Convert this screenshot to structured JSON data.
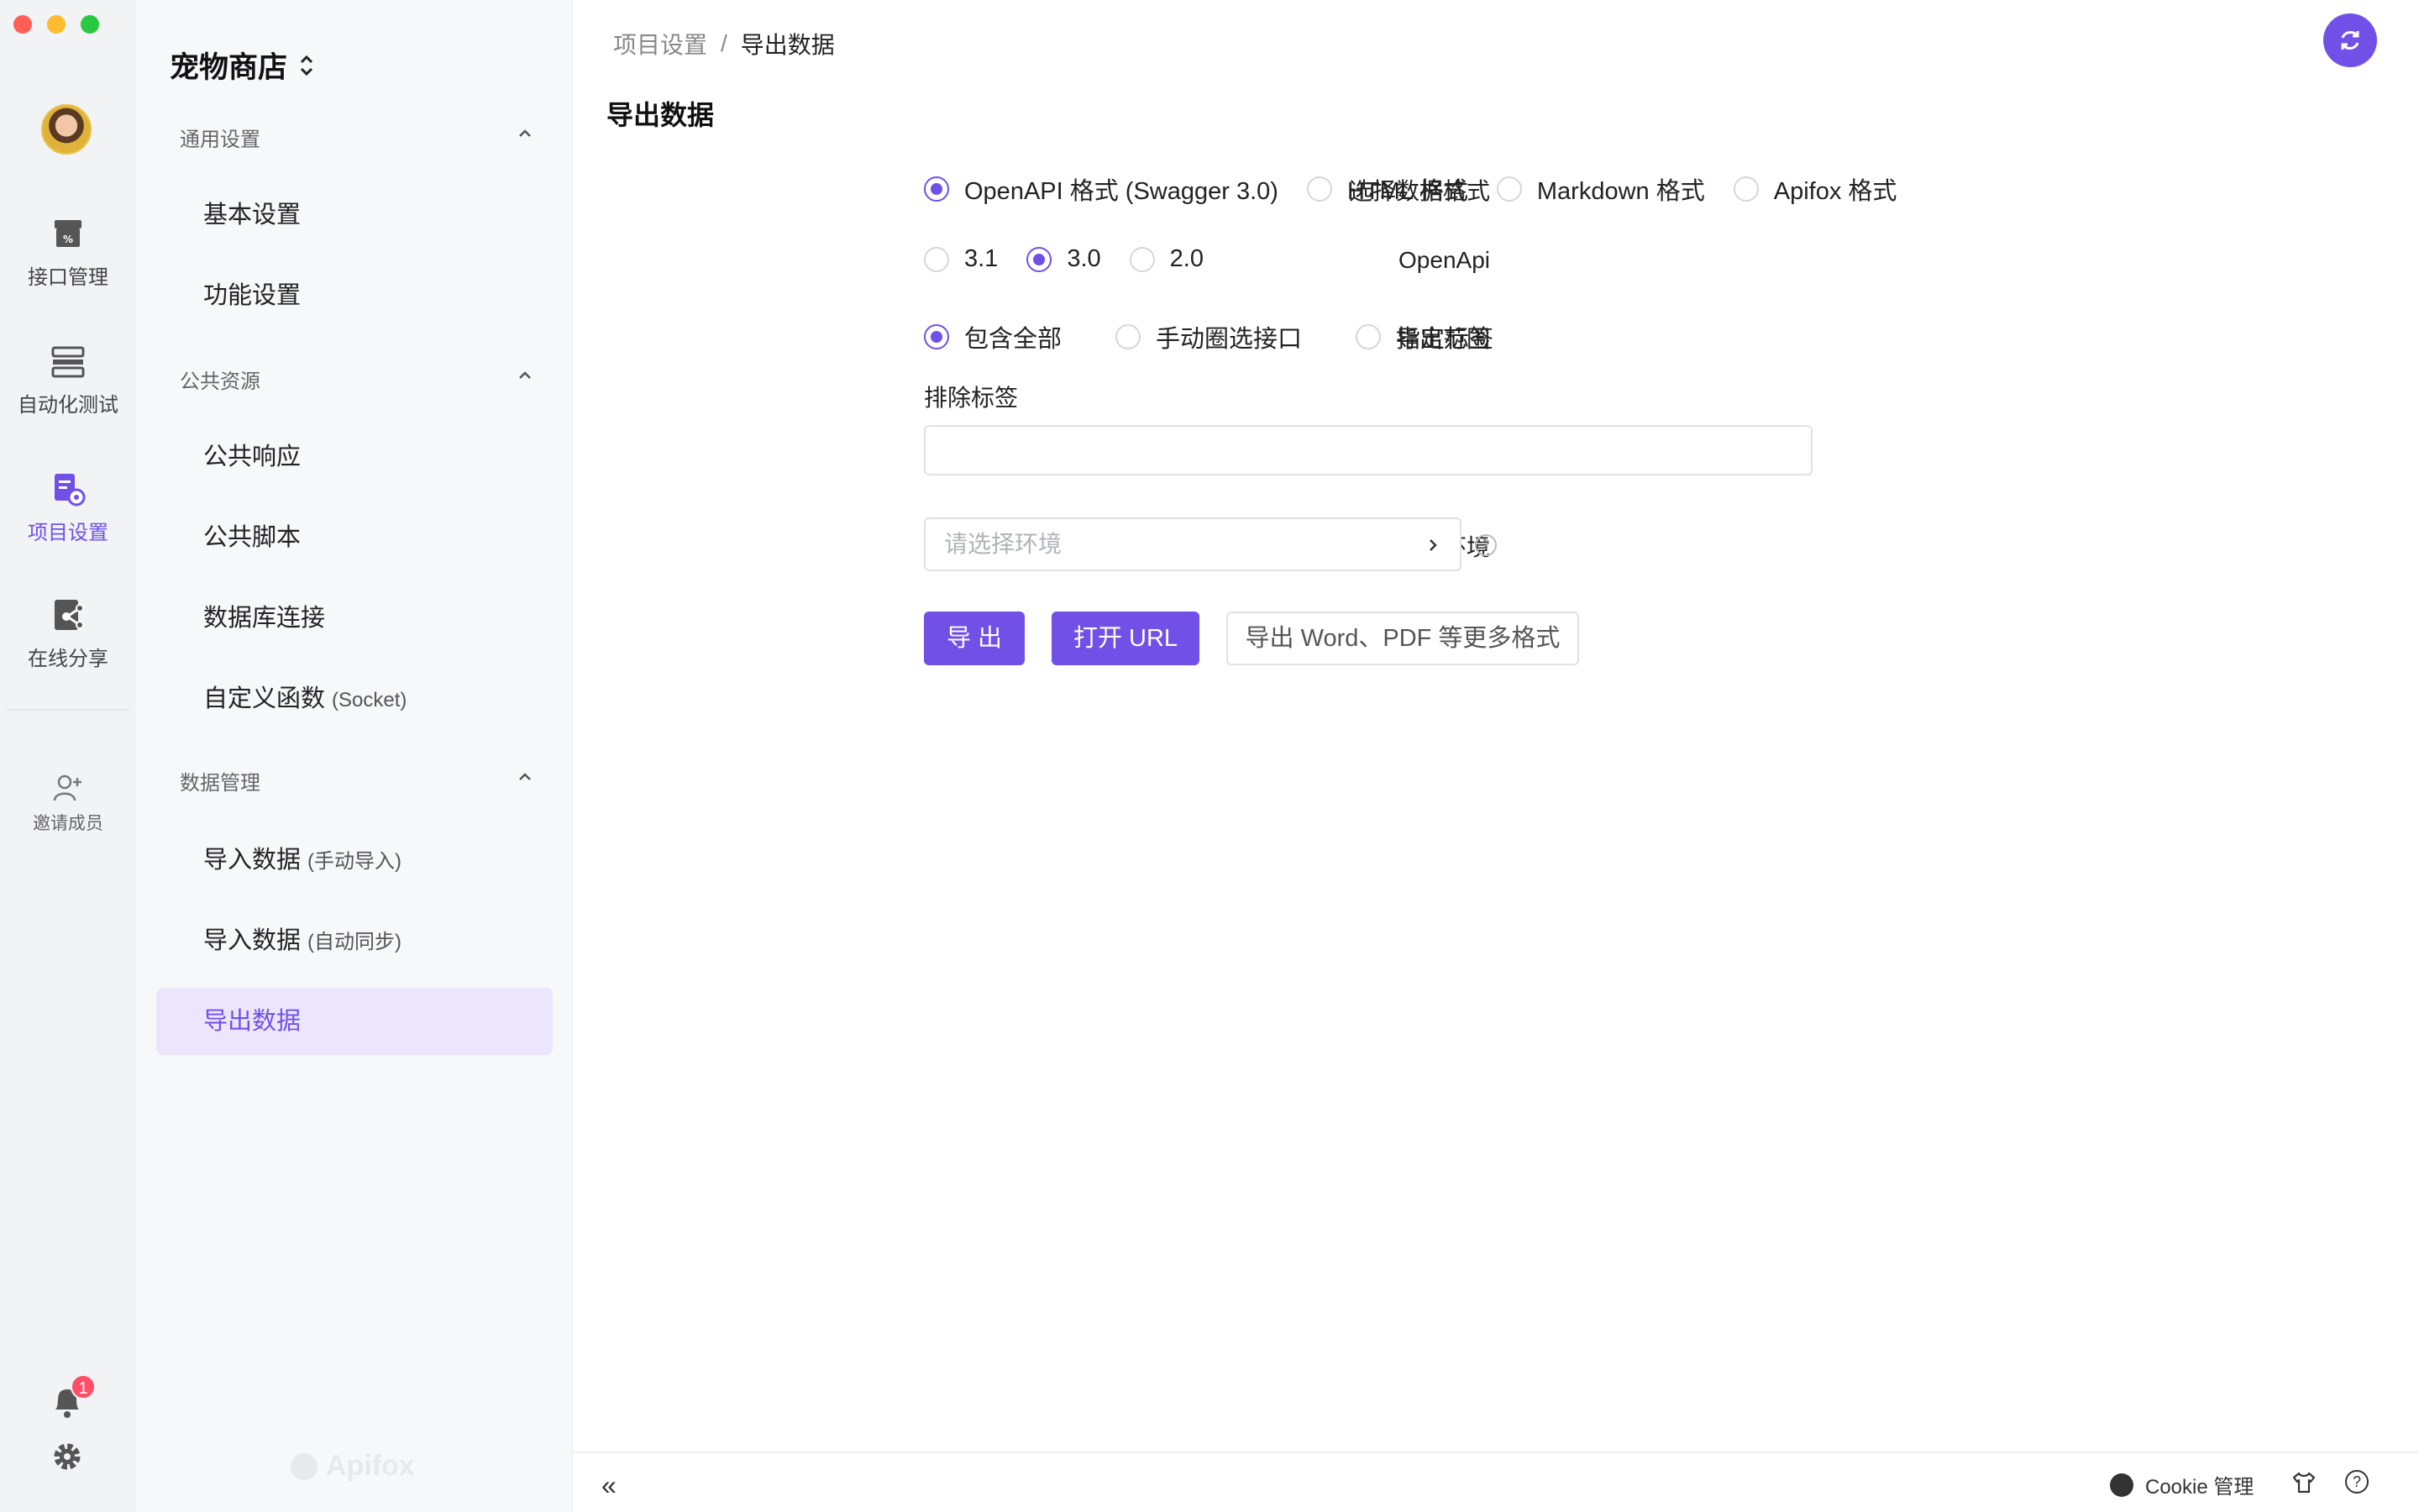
{
  "rail": {
    "items": [
      {
        "label": "接口管理",
        "icon": "api-icon"
      },
      {
        "label": "自动化测试",
        "icon": "automation-icon"
      },
      {
        "label": "项目设置",
        "icon": "project-settings-icon",
        "active": true
      },
      {
        "label": "在线分享",
        "icon": "share-icon"
      }
    ],
    "invite_label": "邀请成员",
    "notification_count": "1"
  },
  "sidebar": {
    "project_name": "宠物商店",
    "groups": [
      {
        "title": "通用设置",
        "items": [
          {
            "label": "基本设置"
          },
          {
            "label": "功能设置"
          }
        ]
      },
      {
        "title": "公共资源",
        "items": [
          {
            "label": "公共响应"
          },
          {
            "label": "公共脚本"
          },
          {
            "label": "数据库连接"
          },
          {
            "label": "自定义函数",
            "sub": "(Socket)"
          }
        ]
      },
      {
        "title": "数据管理",
        "items": [
          {
            "label": "导入数据",
            "sub": "(手动导入)"
          },
          {
            "label": "导入数据",
            "sub": "(自动同步)"
          },
          {
            "label": "导出数据",
            "active": true
          }
        ]
      }
    ],
    "watermark": "Apifox"
  },
  "main": {
    "breadcrumb": {
      "parent": "项目设置",
      "separator": "/",
      "current": "导出数据"
    },
    "title": "导出数据",
    "format": {
      "label": "选择数据格式",
      "options": [
        "OpenAPI 格式 (Swagger 3.0)",
        "HTML 格式",
        "Markdown 格式",
        "Apifox 格式"
      ],
      "selected": "OpenAPI 格式 (Swagger 3.0)"
    },
    "openapi": {
      "label": "OpenApi",
      "options": [
        "3.1",
        "3.0",
        "2.0"
      ],
      "selected": "3.0"
    },
    "scope": {
      "label": "导出范围",
      "options": [
        "包含全部",
        "手动圈选接口",
        "指定标签"
      ],
      "selected": "包含全部"
    },
    "exclude_tags": {
      "label": "排除标签",
      "value": ""
    },
    "environment": {
      "label": "运行环境",
      "placeholder": "请选择环境",
      "help": "?"
    },
    "buttons": {
      "export": "导 出",
      "open_url": "打开 URL",
      "more_formats": "导出 Word、PDF 等更多格式"
    }
  },
  "footer": {
    "collapse": "«",
    "cookie": "Cookie 管理",
    "help": "?"
  },
  "colors": {
    "accent": "#7150e8",
    "rail_bg": "#f1f3f5",
    "sidebar_bg": "#f7f8fa",
    "active_bg": "#ebe6fb",
    "badge": "#ff4d6a"
  }
}
